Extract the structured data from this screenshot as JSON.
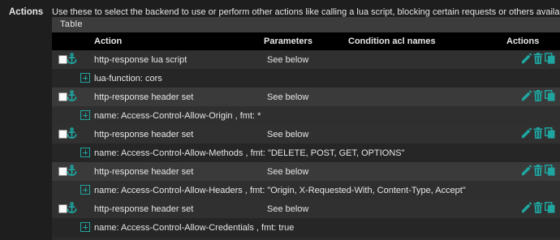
{
  "section": {
    "label": "Actions",
    "description": "Use these to select the backend to use or perform other actions like calling a lua script, blocking certain requests or others available."
  },
  "table": {
    "title": "Table",
    "columns": {
      "action": "Action",
      "parameters": "Parameters",
      "condition": "Condition acl names",
      "actions": "Actions"
    },
    "rows": [
      {
        "action": "http-response lua script",
        "parameters": "See below",
        "detail": "lua-function: cors"
      },
      {
        "action": "http-response header set",
        "parameters": "See below",
        "detail": "name: Access-Control-Allow-Origin , fmt: *"
      },
      {
        "action": "http-response header set",
        "parameters": "See below",
        "detail": "name: Access-Control-Allow-Methods , fmt: \"DELETE, POST, GET, OPTIONS\""
      },
      {
        "action": "http-response header set",
        "parameters": "See below",
        "detail": "name: Access-Control-Allow-Headers , fmt: \"Origin, X-Requested-With, Content-Type, Accept\""
      },
      {
        "action": "http-response header set",
        "parameters": "See below",
        "detail": "name: Access-Control-Allow-Credentials , fmt: true"
      }
    ]
  },
  "colors": {
    "accent": "#1fa5a0",
    "header_bg": "#000000",
    "page_bg": "#1e1e1e"
  },
  "icons": {
    "row_handle": "anchor-icon",
    "expand": "plus-square-icon",
    "edit": "pencil-icon",
    "delete": "trash-icon",
    "copy": "copy-icon"
  }
}
